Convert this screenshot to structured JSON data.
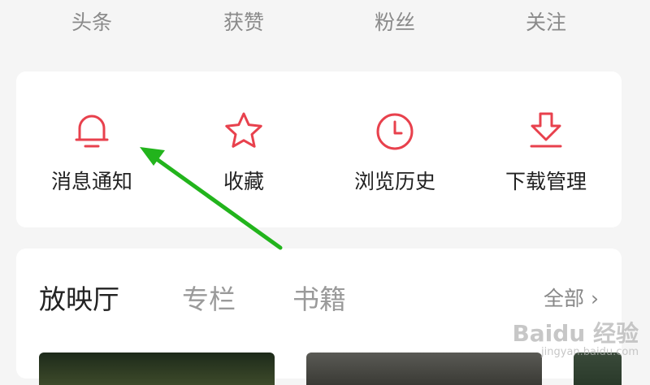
{
  "stats": [
    {
      "label": "头条"
    },
    {
      "label": "获赞"
    },
    {
      "label": "粉丝"
    },
    {
      "label": "关注"
    }
  ],
  "quick_actions": [
    {
      "label": "消息通知",
      "icon": "bell-icon"
    },
    {
      "label": "收藏",
      "icon": "star-icon"
    },
    {
      "label": "浏览历史",
      "icon": "clock-icon"
    },
    {
      "label": "下载管理",
      "icon": "download-icon"
    }
  ],
  "media": {
    "tabs": [
      {
        "label": "放映厅",
        "active": true
      },
      {
        "label": "专栏",
        "active": false
      },
      {
        "label": "书籍",
        "active": false
      }
    ],
    "more_label": "全部 ›"
  },
  "watermark": {
    "brand": "Baidu 经验",
    "url": "jingyan.baidu.com"
  },
  "colors": {
    "accent": "#e8414d",
    "annotation_arrow": "#22b41c",
    "background": "#f5f5f5"
  }
}
